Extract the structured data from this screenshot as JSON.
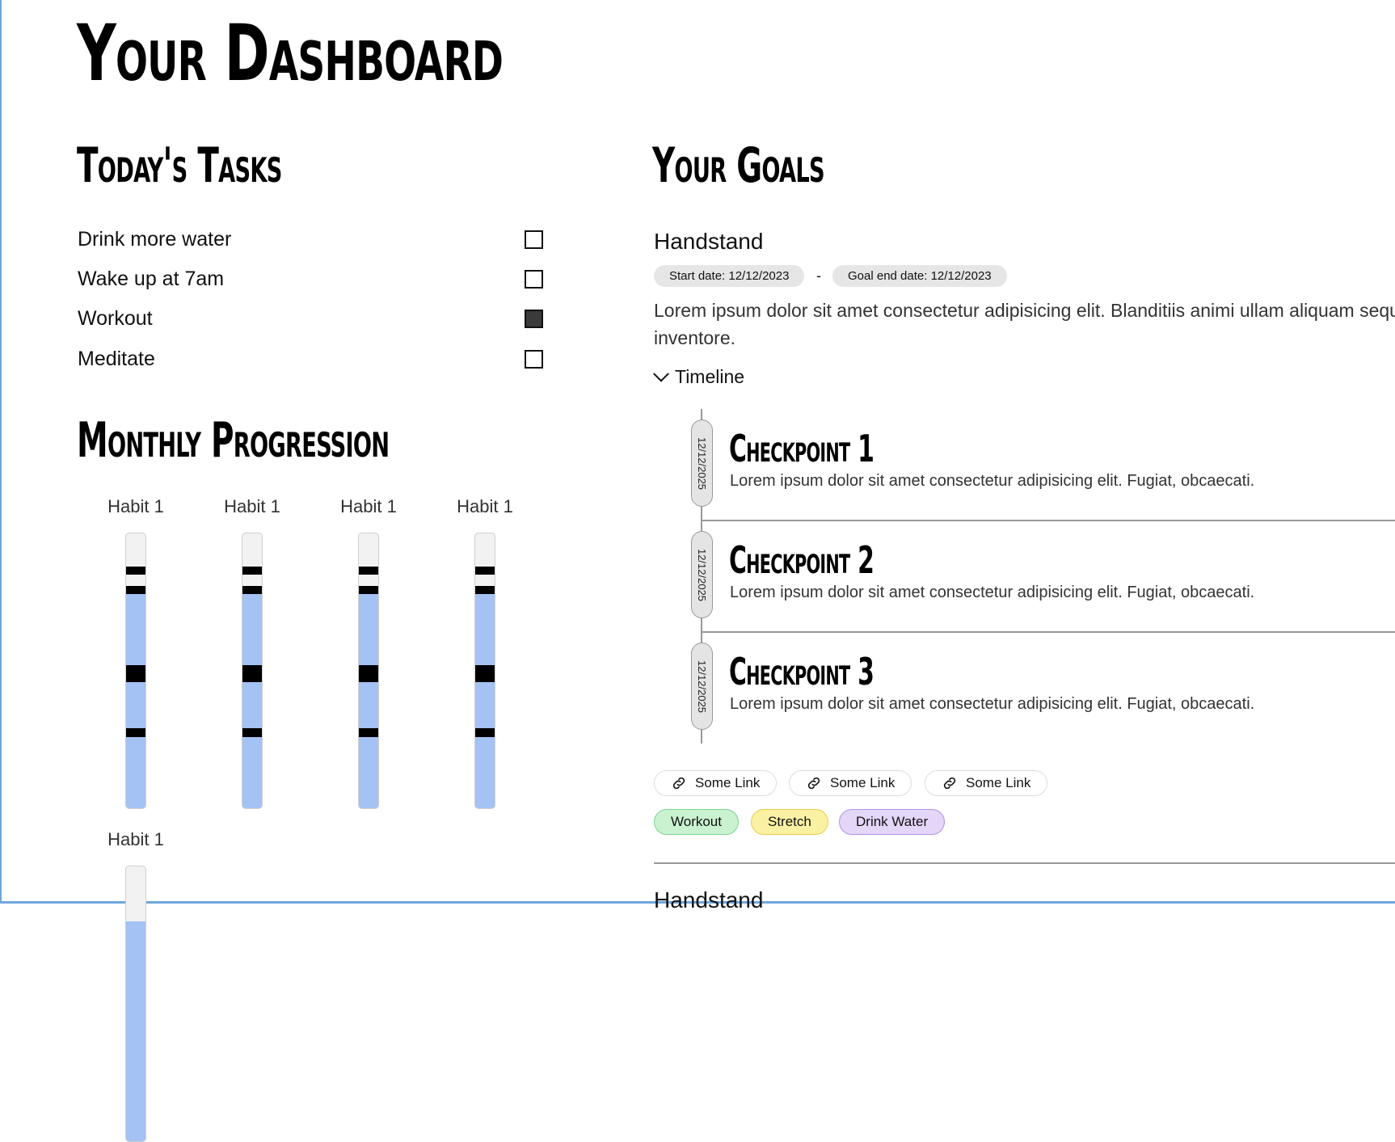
{
  "page": {
    "title": "Your Dashboard"
  },
  "tasks": {
    "heading": "Today's Tasks",
    "items": [
      {
        "label": "Drink more water",
        "checked": false
      },
      {
        "label": "Wake up at 7am",
        "checked": false
      },
      {
        "label": "Workout",
        "checked": true
      },
      {
        "label": "Meditate",
        "checked": false
      }
    ]
  },
  "progression": {
    "heading": "Monthly Progression",
    "habits": [
      {
        "label": "Habit 1",
        "filled_fraction": 0.8,
        "marks": [
          0.12,
          0.19,
          0.48,
          0.71
        ]
      },
      {
        "label": "Habit 1",
        "filled_fraction": 0.8,
        "marks": [
          0.12,
          0.19,
          0.48,
          0.71
        ]
      },
      {
        "label": "Habit 1",
        "filled_fraction": 0.8,
        "marks": [
          0.12,
          0.19,
          0.48,
          0.71
        ]
      },
      {
        "label": "Habit 1",
        "filled_fraction": 0.8,
        "marks": [
          0.12,
          0.19,
          0.48,
          0.71
        ]
      },
      {
        "label": "Habit 1",
        "filled_fraction": 0.8,
        "marks": []
      }
    ]
  },
  "goals": {
    "heading": "Your Goals",
    "items": [
      {
        "title": "Handstand",
        "start_date": "Start date: 12/12/2023",
        "separator": "-",
        "end_date": "Goal end date: 12/12/2023",
        "description_line1": "Lorem ipsum dolor sit amet consectetur adipisicing elit. Blanditiis animi ullam aliquam sequ",
        "description_line2": "inventore.",
        "timeline_label": "Timeline",
        "checkpoints": [
          {
            "date": "12/12/2025",
            "title": "Checkpoint 1",
            "description": "Lorem ipsum dolor sit amet consectetur adipisicing elit. Fugiat, obcaecati."
          },
          {
            "date": "12/12/2025",
            "title": "Checkpoint 2",
            "description": "Lorem ipsum dolor sit amet consectetur adipisicing elit. Fugiat, obcaecati."
          },
          {
            "date": "12/12/2025",
            "title": "Checkpoint 3",
            "description": "Lorem ipsum dolor sit amet consectetur adipisicing elit. Fugiat, obcaecati."
          }
        ],
        "links": [
          {
            "label": "Some Link",
            "icon": "link-icon"
          },
          {
            "label": "Some Link",
            "icon": "link-icon"
          },
          {
            "label": "Some Link",
            "icon": "link-icon"
          }
        ],
        "tags": [
          {
            "label": "Workout",
            "color": "#c9f2d0"
          },
          {
            "label": "Stretch",
            "color": "#fbf1a3"
          },
          {
            "label": "Drink Water",
            "color": "#e4d6f8"
          }
        ]
      },
      {
        "title": "Handstand"
      }
    ]
  },
  "colors": {
    "habit_fill": "#a4c2f4",
    "habit_mark": "#000000",
    "frame": "#6fa8dc"
  }
}
